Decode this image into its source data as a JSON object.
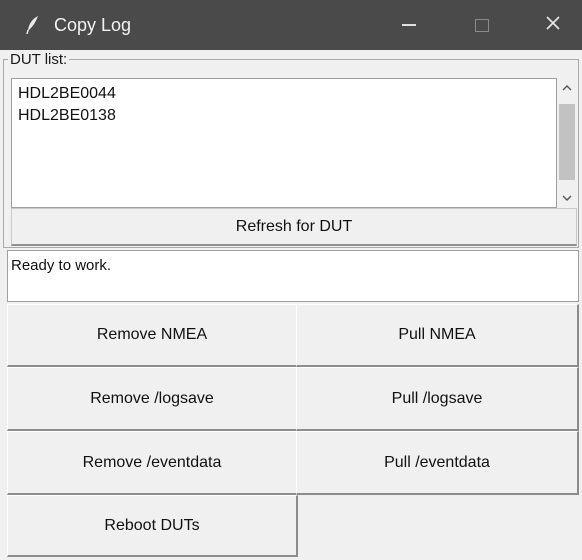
{
  "window": {
    "title": "Copy Log",
    "icon": "feather-icon"
  },
  "titlebar_controls": {
    "minimize": "minimize-icon",
    "maximize": "maximize-icon",
    "close_glyph": "✕"
  },
  "dut_group": {
    "legend": "DUT list:",
    "items": [
      "HDL2BE0044",
      "HDL2BE0138"
    ],
    "scroll_up_glyph": "⌃",
    "scroll_down_glyph": "⌄"
  },
  "refresh_button": {
    "label": "Refresh for DUT"
  },
  "status": {
    "text": "Ready to work."
  },
  "actions": {
    "remove_nmea": "Remove NMEA",
    "pull_nmea": "Pull NMEA",
    "remove_logsave": "Remove /logsave",
    "pull_logsave": "Pull /logsave",
    "remove_eventdata": "Remove /eventdata",
    "pull_eventdata": "Pull /eventdata",
    "reboot": "Reboot DUTs"
  }
}
